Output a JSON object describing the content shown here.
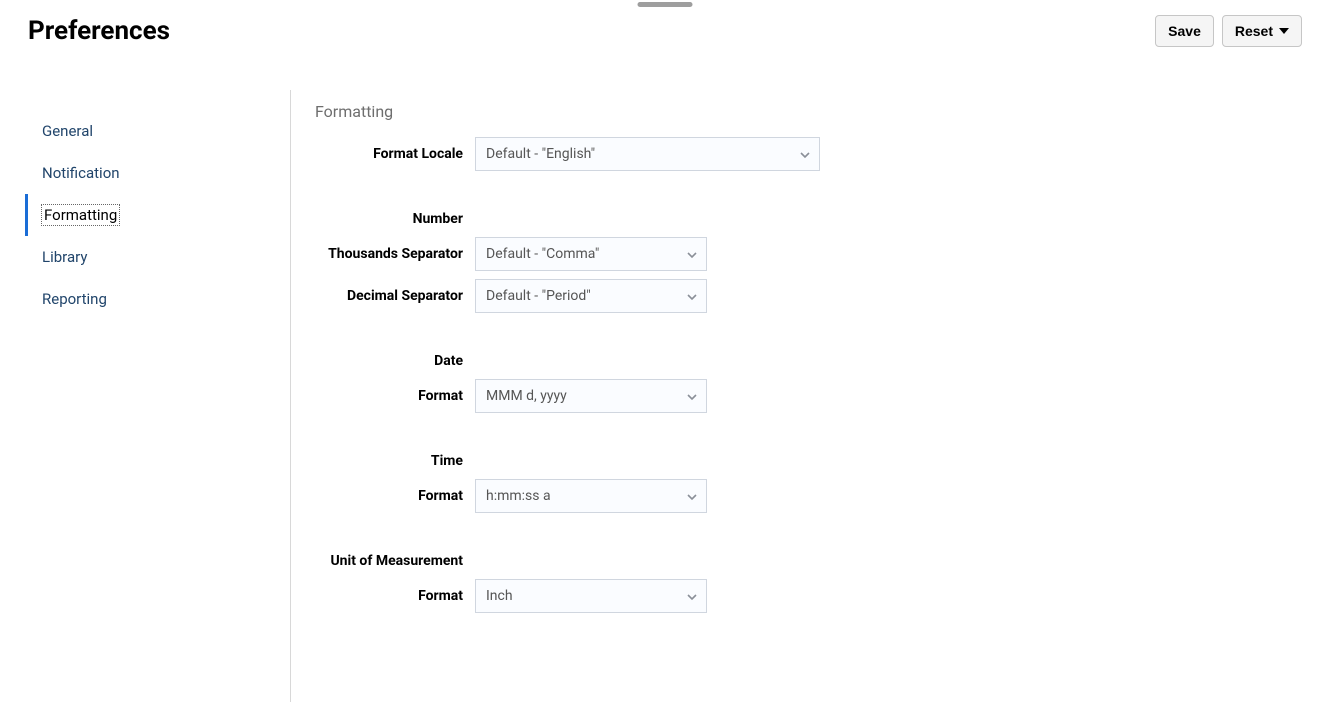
{
  "page": {
    "title": "Preferences"
  },
  "actions": {
    "save": "Save",
    "reset": "Reset"
  },
  "sidebar": {
    "items": [
      {
        "label": "General",
        "active": false
      },
      {
        "label": "Notification",
        "active": false
      },
      {
        "label": "Formatting",
        "active": true
      },
      {
        "label": "Library",
        "active": false
      },
      {
        "label": "Reporting",
        "active": false
      }
    ]
  },
  "formatting": {
    "section_title": "Formatting",
    "format_locale": {
      "label": "Format Locale",
      "value": "Default - \"English\""
    },
    "groups": {
      "number": {
        "heading": "Number",
        "thousands": {
          "label": "Thousands Separator",
          "value": "Default - \"Comma\""
        },
        "decimal": {
          "label": "Decimal Separator",
          "value": "Default - \"Period\""
        }
      },
      "date": {
        "heading": "Date",
        "format": {
          "label": "Format",
          "value": "MMM d, yyyy"
        }
      },
      "time": {
        "heading": "Time",
        "format": {
          "label": "Format",
          "value": "h:mm:ss a"
        }
      },
      "uom": {
        "heading": "Unit of Measurement",
        "format": {
          "label": "Format",
          "value": "Inch"
        }
      }
    }
  }
}
